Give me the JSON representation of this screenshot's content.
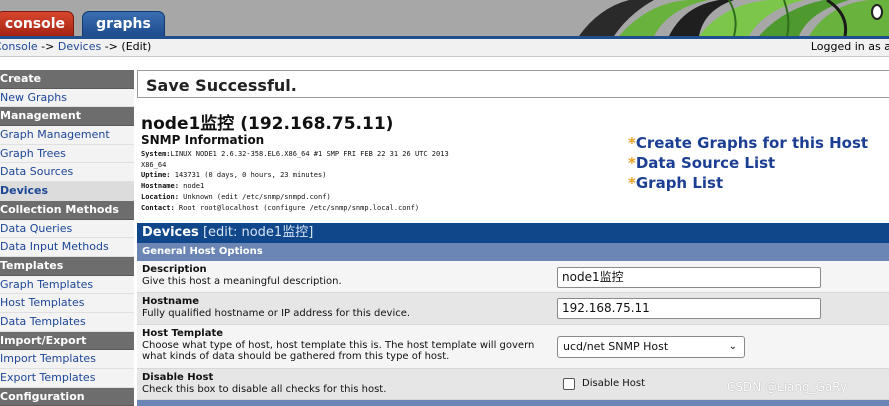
{
  "tabs": {
    "console": "console",
    "graphs": "graphs"
  },
  "breadcrumb": {
    "console": "Console",
    "sep1": " -> ",
    "devices": "Devices",
    "sep2": " -> ",
    "current": "(Edit)"
  },
  "logged_in": "Logged in as a",
  "sidebar": {
    "items": [
      {
        "label": "Create",
        "type": "header"
      },
      {
        "label": "New Graphs",
        "type": "item"
      },
      {
        "label": "Management",
        "type": "header"
      },
      {
        "label": "Graph Management",
        "type": "item"
      },
      {
        "label": "Graph Trees",
        "type": "item"
      },
      {
        "label": "Data Sources",
        "type": "item"
      },
      {
        "label": "Devices",
        "type": "active"
      },
      {
        "label": "Collection Methods",
        "type": "header"
      },
      {
        "label": "Data Queries",
        "type": "item"
      },
      {
        "label": "Data Input Methods",
        "type": "item"
      },
      {
        "label": "Templates",
        "type": "header"
      },
      {
        "label": "Graph Templates",
        "type": "item"
      },
      {
        "label": "Host Templates",
        "type": "item"
      },
      {
        "label": "Data Templates",
        "type": "item"
      },
      {
        "label": "Import/Export",
        "type": "header"
      },
      {
        "label": "Import Templates",
        "type": "item"
      },
      {
        "label": "Export Templates",
        "type": "item"
      },
      {
        "label": "Configuration",
        "type": "header"
      }
    ]
  },
  "message": "Save Successful.",
  "host_title": "node1监控 (192.168.75.11)",
  "snmp": {
    "heading": "SNMP Information",
    "system_label": "System:",
    "system_value": "LINUX NODE1 2.6.32-358.EL6.X86_64 #1 SMP FRI FEB 22 31 26 UTC 2013",
    "system_value2": "X86_64",
    "uptime_label": "Uptime:",
    "uptime_value": " 143731  (0 days, 0 hours, 23 minutes)",
    "hostname_label": "Hostname:",
    "hostname_value": " node1",
    "location_label": "Location:",
    "location_value": " Unknown (edit /etc/snmp/snmpd.conf)",
    "contact_label": "Contact:",
    "contact_value": " Root root@localhost (configure /etc/snmp/snmp.local.conf)"
  },
  "links": {
    "create_graphs": "Create Graphs for this Host",
    "data_source_list": "Data Source List",
    "graph_list": "Graph List"
  },
  "devices_header": {
    "title": "Devices",
    "edit": " [edit: node1监控]"
  },
  "options_header": "General Host Options",
  "fields": {
    "description": {
      "title": "Description",
      "help": "Give this host a meaningful description.",
      "value": "node1监控"
    },
    "hostname": {
      "title": "Hostname",
      "help": "Fully qualified hostname or IP address for this device.",
      "value": "192.168.75.11"
    },
    "host_template": {
      "title": "Host Template",
      "help": "Choose what type of host, host template this is. The host template will govern what kinds of data should be gathered from this type of host.",
      "value": "ucd/net SNMP Host"
    },
    "disable_host": {
      "title": "Disable Host",
      "help": "Check this box to disable all checks for this host.",
      "checkbox_label": "Disable Host",
      "checked": false
    }
  },
  "watermark": "CSDN @Liang_GaRy",
  "colors": {
    "accent": "#10478a",
    "console_tab": "#c0351f",
    "graphs_tab": "#2a5ea3",
    "sidebar_header": "#6d6d6d",
    "link": "#1c3f94",
    "star": "#f0a020"
  }
}
